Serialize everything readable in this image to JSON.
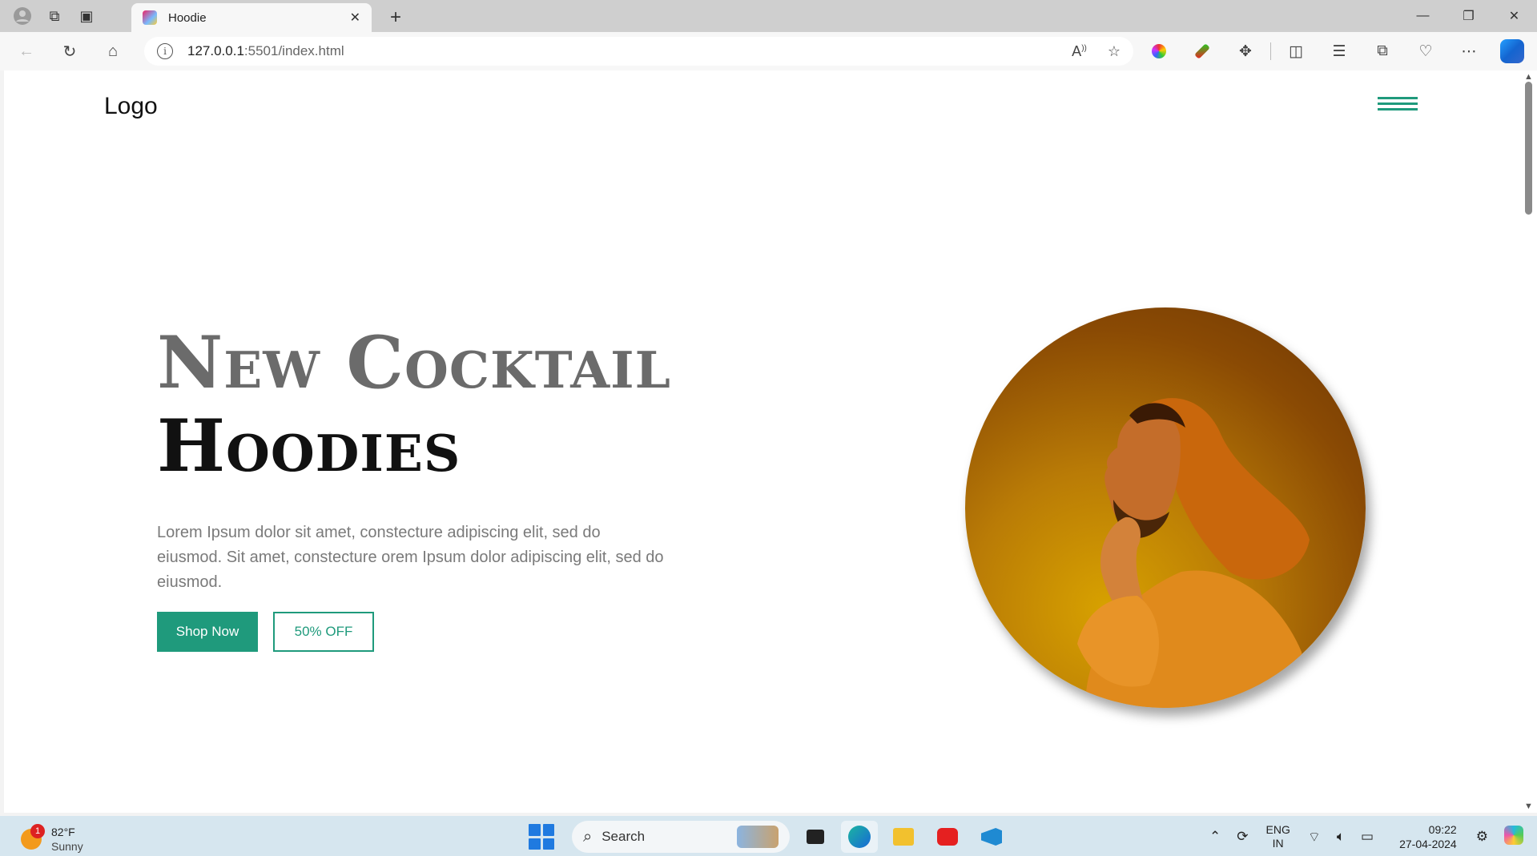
{
  "browser": {
    "tab_title": "Hoodie",
    "url_host": "127.0.0.1",
    "url_path": ":5501/index.html"
  },
  "page": {
    "logo_text": "Logo",
    "hero": {
      "line1": "New Cocktail",
      "line2": "Hoodies",
      "description": "Lorem Ipsum dolor sit amet, constecture adipiscing elit, sed do eiusmod. Sit amet, constecture orem Ipsum dolor adipiscing elit, sed do eiusmod.",
      "primary_button": "Shop Now",
      "secondary_button": "50% OFF"
    },
    "accent_color": "#1f9a7c"
  },
  "taskbar": {
    "weather_temp": "82°F",
    "weather_condition": "Sunny",
    "weather_badge": "1",
    "search_label": "Search",
    "lang_line1": "ENG",
    "lang_line2": "IN",
    "time": "09:22",
    "date": "27-04-2024"
  }
}
